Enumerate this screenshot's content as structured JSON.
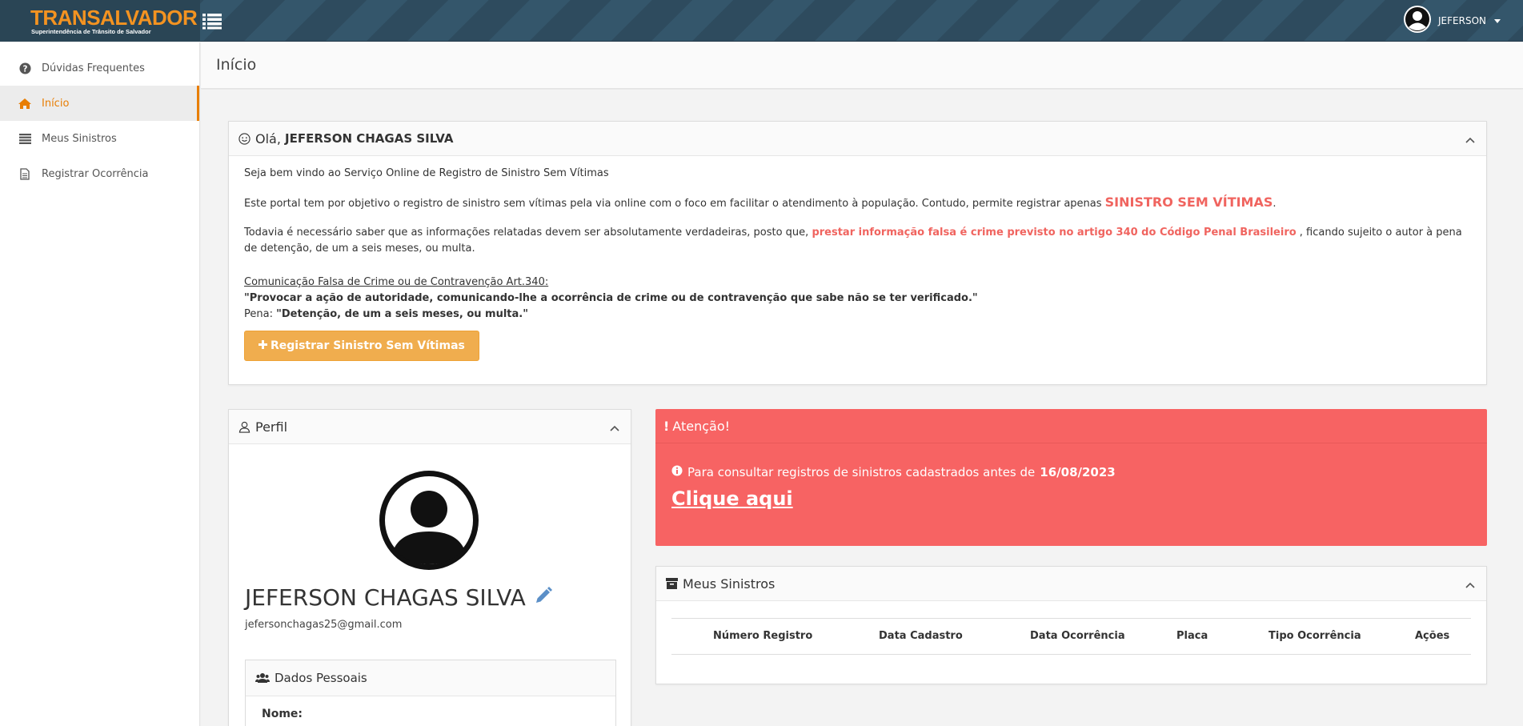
{
  "brand": {
    "name": "TRANSALVADOR",
    "subtitle": "Superintendência de Trânsito de Salvador",
    "color": "#f39321"
  },
  "header": {
    "user_name": "JEFERSON"
  },
  "sidebar": {
    "items": [
      {
        "label": "Dúvidas Frequentes",
        "icon": "question-circle-icon",
        "active": false
      },
      {
        "label": "Início",
        "icon": "home-icon",
        "active": true
      },
      {
        "label": "Meus Sinistros",
        "icon": "list-icon",
        "active": false
      },
      {
        "label": "Registrar Ocorrência",
        "icon": "file-icon",
        "active": false
      }
    ],
    "active_color": "#e87e04"
  },
  "page": {
    "title": "Início"
  },
  "welcome": {
    "greeting": "Olá,",
    "name": "JEFERSON CHAGAS SILVA",
    "p1": "Seja bem vindo ao Serviço Online de Registro de Sinistro Sem Vítimas",
    "p2_pre": "Este portal tem por objetivo o registro de sinistro sem vítimas pela via online com o foco em facilitar o atendimento à população. Contudo, permite registrar apenas",
    "p2_highlight": "SINISTRO SEM VÍTIMAS",
    "p2_post": ".",
    "p3_pre": "Todavia é necessário saber que as informações relatadas devem ser absolutamente verdadeiras, posto que,",
    "p3_highlight": "prestar informação falsa é crime previsto no artigo 340 do Código Penal Brasileiro",
    "p3_post": ", ficando sujeito o autor à pena de detenção, de um a seis meses, ou multa.",
    "law_title": "Comunicação Falsa de Crime ou de Contravenção Art.340:",
    "law_quote": "\"Provocar a ação de autoridade, comunicando-lhe a ocorrência de crime ou de contravenção que sabe não se ter verificado.\"",
    "penalty_label": "Pena:",
    "penalty_text": "\"Detenção, de um a seis meses, ou multa.\"",
    "button_label": "Registrar Sinistro Sem Vítimas",
    "highlight_color": "#f0645f"
  },
  "perfil": {
    "title": "Perfil",
    "name": "JEFERSON CHAGAS SILVA",
    "email": "jefersonchagas25@gmail.com",
    "dados_title": "Dados Pessoais",
    "nome_label": "Nome:"
  },
  "atencao": {
    "title": "Atenção!",
    "text": "Para consultar registros de sinistros cadastrados antes de",
    "date": "16/08/2023",
    "link": "Clique aqui",
    "color": "#f76363"
  },
  "sinistros": {
    "title": "Meus Sinistros",
    "columns": [
      "Número Registro",
      "Data Cadastro",
      "Data Ocorrência",
      "Placa",
      "Tipo Ocorrência",
      "Ações"
    ]
  }
}
